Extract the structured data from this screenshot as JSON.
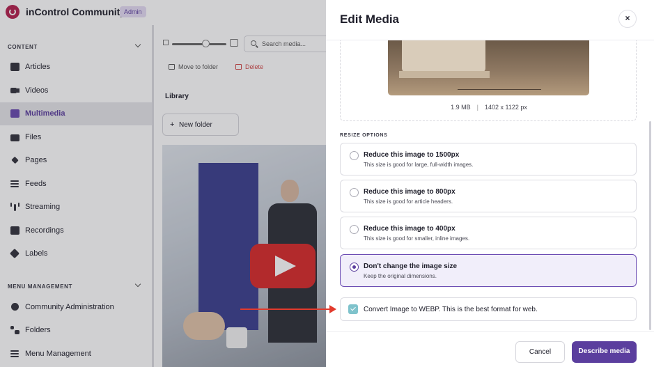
{
  "app": {
    "title": "inControl Community",
    "badge": "Admin"
  },
  "sidebar": {
    "content_section": "CONTENT",
    "content_items": [
      {
        "label": "Articles",
        "icon": "articles-icon"
      },
      {
        "label": "Videos",
        "icon": "video-camera-icon"
      },
      {
        "label": "Multimedia",
        "icon": "multimedia-icon",
        "active": true
      },
      {
        "label": "Files",
        "icon": "folder-icon"
      },
      {
        "label": "Pages",
        "icon": "layers-icon"
      },
      {
        "label": "Feeds",
        "icon": "list-icon"
      },
      {
        "label": "Streaming",
        "icon": "broadcast-icon"
      },
      {
        "label": "Recordings",
        "icon": "film-icon"
      },
      {
        "label": "Labels",
        "icon": "tag-icon"
      }
    ],
    "menu_section": "MENU MANAGEMENT",
    "menu_items": [
      {
        "label": "Community Administration",
        "icon": "gear-icon"
      },
      {
        "label": "Folders",
        "icon": "folder-tree-icon"
      },
      {
        "label": "Menu Management",
        "icon": "menu-icon"
      }
    ]
  },
  "library": {
    "search_placeholder": "Search media...",
    "move_label": "Move to folder",
    "delete_label": "Delete",
    "heading": "Library",
    "new_folder_label": "New folder"
  },
  "drawer": {
    "title": "Edit Media",
    "close_glyph": "×",
    "image_size": "1.9 MB",
    "image_separator": "|",
    "image_dimensions": "1402 x 1122 px",
    "resize_heading": "RESIZE OPTIONS",
    "options": [
      {
        "title": "Reduce this image to 1500px",
        "desc": "This size is good for large, full-width images.",
        "selected": false
      },
      {
        "title": "Reduce this image to 800px",
        "desc": "This size is good for article headers.",
        "selected": false
      },
      {
        "title": "Reduce this image to 400px",
        "desc": "This size is good for smaller, inline images.",
        "selected": false
      },
      {
        "title": "Don't change the image size",
        "desc": "Keep the original dimensions.",
        "selected": true
      }
    ],
    "webp_label": "Convert Image to WEBP. This is the best format for web.",
    "webp_checked": true,
    "cancel_label": "Cancel",
    "primary_label": "Describe media"
  },
  "colors": {
    "accent": "#5b3e9e",
    "checkbox": "#7fc3cc",
    "delete": "#d24a4a",
    "annotation_arrow": "#e23a2c"
  }
}
